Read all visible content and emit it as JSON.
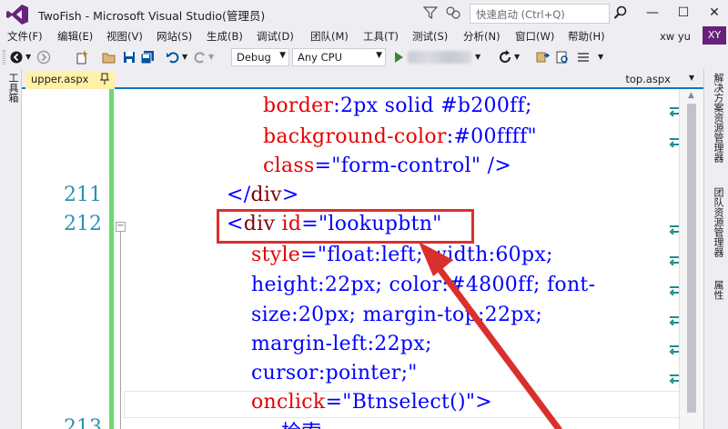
{
  "window": {
    "title": "TwoFish - Microsoft Visual Studio(管理员)",
    "quick_launch_placeholder": "快速启动 (Ctrl+Q)",
    "minimize": "—",
    "maximize": "☐",
    "close": "✕"
  },
  "menu": {
    "items": [
      "文件(F)",
      "编辑(E)",
      "视图(V)",
      "网站(S)",
      "生成(B)",
      "调试(D)",
      "团队(M)",
      "工具(T)",
      "测试(S)",
      "分析(N)",
      "窗口(W)",
      "帮助(H)"
    ],
    "user_name": "xw yu",
    "user_initials": "XY"
  },
  "toolbar": {
    "configuration": "Debug",
    "platform": "Any CPU"
  },
  "side_panels": {
    "left": "工具箱",
    "right": [
      "解决方案资源管理器",
      "团队资源管理器",
      "属性"
    ]
  },
  "tabs": {
    "active": "upper.aspx",
    "other": "top.aspx"
  },
  "editor": {
    "lines": [
      {
        "num": "",
        "parts": [
          [
            "attr",
            "border"
          ],
          [
            "punc",
            ":"
          ],
          [
            "val",
            "2px solid #b200ff"
          ],
          [
            "punc",
            ";"
          ]
        ]
      },
      {
        "num": "",
        "parts": [
          [
            "attr",
            "background-color"
          ],
          [
            "punc",
            ":"
          ],
          [
            "val",
            "#00ffff"
          ],
          [
            "punc",
            "\""
          ]
        ]
      },
      {
        "num": "",
        "parts": [
          [
            "attr",
            "class"
          ],
          [
            "punc",
            "=\""
          ],
          [
            "val",
            "form-control"
          ],
          [
            "punc",
            "\" />"
          ]
        ]
      },
      {
        "num": "211",
        "parts": [
          [
            "punc",
            "</"
          ],
          [
            "tag",
            "div"
          ],
          [
            "punc",
            ">"
          ]
        ]
      },
      {
        "num": "212",
        "parts": [
          [
            "punc",
            "<"
          ],
          [
            "tag",
            "div "
          ],
          [
            "attr",
            "id"
          ],
          [
            "punc",
            "=\""
          ],
          [
            "val",
            "lookupbtn"
          ],
          [
            "punc",
            "\""
          ]
        ]
      },
      {
        "num": "",
        "parts": [
          [
            "attr",
            "style"
          ],
          [
            "punc",
            "=\""
          ],
          [
            "val",
            "float"
          ],
          [
            "punc",
            ":"
          ],
          [
            "val",
            "left"
          ],
          [
            "punc",
            "; "
          ],
          [
            "val",
            "width"
          ],
          [
            "punc",
            ":"
          ],
          [
            "val",
            "60px"
          ],
          [
            "punc",
            ";"
          ]
        ]
      },
      {
        "num": "",
        "parts": [
          [
            "val",
            "height"
          ],
          [
            "punc",
            ":"
          ],
          [
            "val",
            "22px"
          ],
          [
            "punc",
            "; "
          ],
          [
            "val",
            "color"
          ],
          [
            "punc",
            ":"
          ],
          [
            "val",
            "#4800ff"
          ],
          [
            "punc",
            "; "
          ],
          [
            "val",
            "font-"
          ]
        ]
      },
      {
        "num": "",
        "parts": [
          [
            "val",
            "size"
          ],
          [
            "punc",
            ":"
          ],
          [
            "val",
            "20px"
          ],
          [
            "punc",
            "; "
          ],
          [
            "val",
            "margin-top"
          ],
          [
            "punc",
            ":"
          ],
          [
            "val",
            "22px"
          ],
          [
            "punc",
            ";"
          ]
        ]
      },
      {
        "num": "",
        "parts": [
          [
            "val",
            "margin-left"
          ],
          [
            "punc",
            ":"
          ],
          [
            "val",
            "22px"
          ],
          [
            "punc",
            ";"
          ]
        ]
      },
      {
        "num": "",
        "parts": [
          [
            "val",
            "cursor"
          ],
          [
            "punc",
            ":"
          ],
          [
            "val",
            "pointer"
          ],
          [
            "punc",
            ";\""
          ]
        ]
      },
      {
        "num": "",
        "parts": [
          [
            "attr",
            "onclick"
          ],
          [
            "punc",
            "=\""
          ],
          [
            "val",
            "Btnselect()"
          ],
          [
            "punc",
            "\">"
          ]
        ]
      },
      {
        "num": "213",
        "parts": [
          [
            "val",
            "检索"
          ]
        ]
      }
    ]
  }
}
